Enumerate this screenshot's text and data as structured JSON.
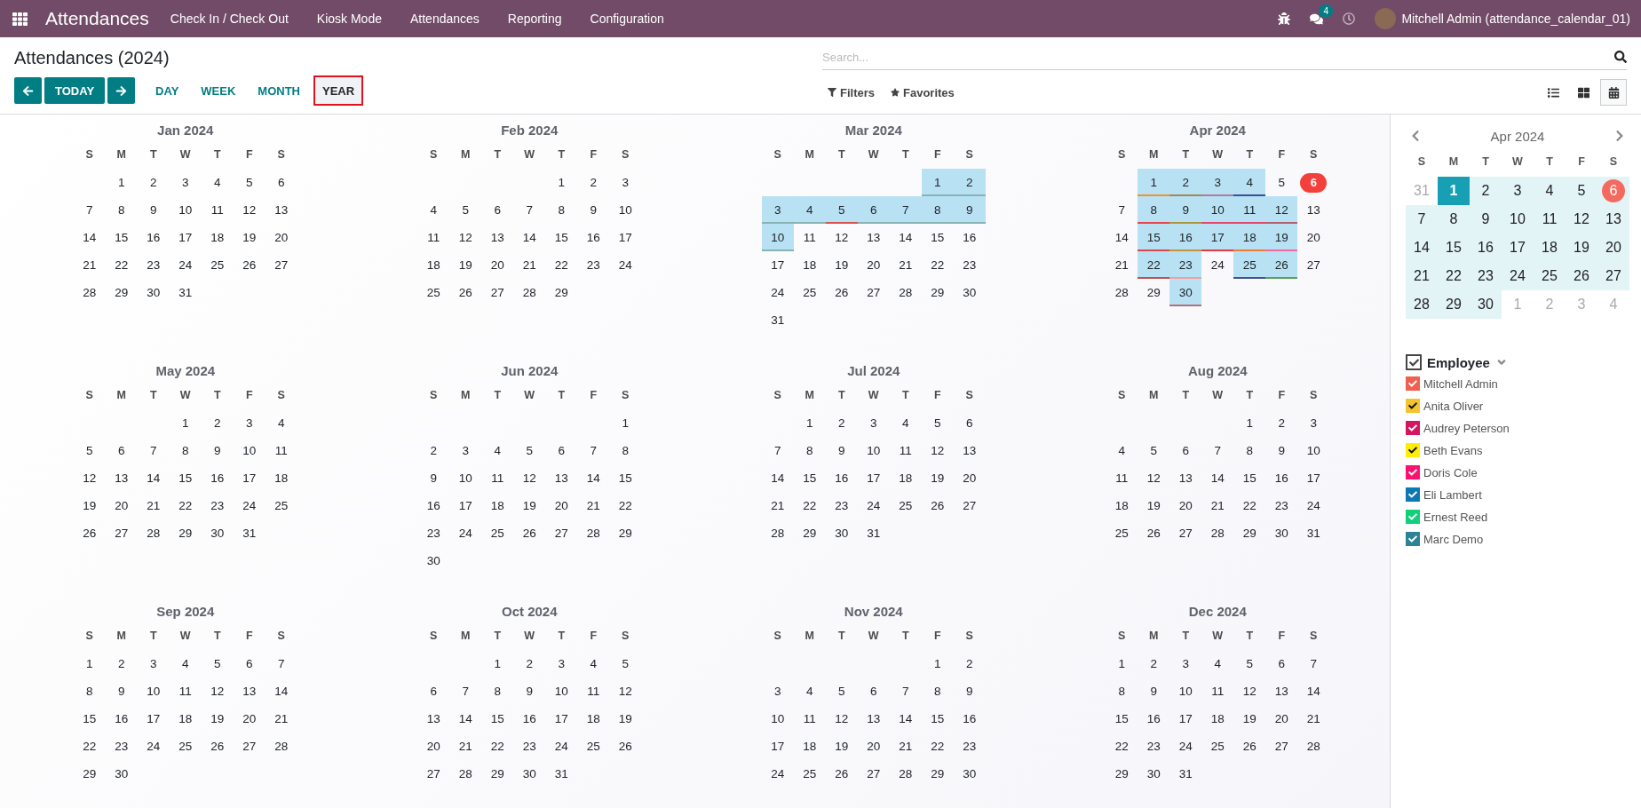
{
  "navbar": {
    "app_name": "Attendances",
    "menu": [
      "Check In / Check Out",
      "Kiosk Mode",
      "Attendances",
      "Reporting",
      "Configuration"
    ],
    "chat_count": "4",
    "user": "Mitchell Admin (attendance_calendar_01)"
  },
  "control_panel": {
    "title": "Attendances (2024)",
    "today_button": "TODAY",
    "scales": [
      {
        "label": "DAY",
        "selected": false
      },
      {
        "label": "WEEK",
        "selected": false
      },
      {
        "label": "MONTH",
        "selected": false
      },
      {
        "label": "YEAR",
        "selected": true
      }
    ],
    "search": {
      "placeholder": "Search..."
    },
    "filters": "Filters",
    "favorites": "Favorites",
    "views": [
      {
        "kind": "list",
        "selected": false
      },
      {
        "kind": "kanban",
        "selected": false
      },
      {
        "kind": "calendar",
        "selected": true
      }
    ]
  },
  "months": [
    {
      "title": "Jan 2024",
      "weekdays": [
        "S",
        "M",
        "T",
        "W",
        "T",
        "F",
        "S"
      ],
      "weeks": [
        {
          "starts_midweek": true,
          "days": [
            "1",
            "2",
            "3",
            "4",
            "5",
            "6"
          ]
        },
        {
          "days": [
            "7",
            "8",
            "9",
            "10",
            "11",
            "12",
            "13"
          ]
        },
        {
          "days": [
            "14",
            "15",
            "16",
            "17",
            "18",
            "19",
            "20"
          ]
        },
        {
          "days": [
            "21",
            "22",
            "23",
            "24",
            "25",
            "26",
            "27"
          ]
        },
        {
          "starts_midweek": false,
          "days": [
            "28",
            "29",
            "30",
            "31"
          ]
        }
      ]
    },
    {
      "title": "Feb 2024",
      "weekdays": [
        "S",
        "M",
        "T",
        "W",
        "T",
        "F",
        "S"
      ],
      "weeks": [
        {
          "starts_midweek": true,
          "days": [
            "1",
            "2",
            "3"
          ]
        },
        {
          "days": [
            "4",
            "5",
            "6",
            "7",
            "8",
            "9",
            "10"
          ]
        },
        {
          "days": [
            "11",
            "12",
            "13",
            "14",
            "15",
            "16",
            "17"
          ]
        },
        {
          "days": [
            "18",
            "19",
            "20",
            "21",
            "22",
            "23",
            "24"
          ]
        },
        {
          "starts_midweek": false,
          "days": [
            "25",
            "26",
            "27",
            "28",
            "29"
          ]
        }
      ]
    },
    {
      "title": "Mar 2024",
      "weekdays": [
        "S",
        "M",
        "T",
        "W",
        "T",
        "F",
        "S"
      ],
      "weeks": [
        {
          "starts_midweek": true,
          "days": [
            {
              "day": "1",
              "color": "#86b4b4"
            },
            {
              "day": "2",
              "color": "#86b4b4"
            }
          ]
        },
        {
          "days": [
            {
              "day": "3",
              "color": "#86b4b4"
            },
            {
              "day": "4",
              "color": "#86b4b4"
            },
            {
              "day": "5",
              "color": "#d9534f"
            },
            {
              "day": "6",
              "color": "#86b4b4"
            },
            {
              "day": "7",
              "color": "#86b4b4"
            },
            {
              "day": "8",
              "color": "#86b4b4"
            },
            {
              "day": "9",
              "color": "#86b4b4"
            }
          ]
        },
        {
          "days": [
            {
              "day": "10",
              "color": "#86b4b4"
            },
            "11",
            "12",
            "13",
            "14",
            "15",
            "16"
          ]
        },
        {
          "days": [
            "17",
            "18",
            "19",
            "20",
            "21",
            "22",
            "23"
          ]
        },
        {
          "days": [
            "24",
            "25",
            "26",
            "27",
            "28",
            "29",
            "30"
          ]
        },
        {
          "starts_midweek": false,
          "days": [
            "31"
          ]
        }
      ]
    },
    {
      "title": "Apr 2024",
      "weekdays": [
        "S",
        "M",
        "T",
        "W",
        "T",
        "F",
        "S"
      ],
      "weeks": [
        {
          "starts_midweek": true,
          "days": [
            {
              "day": "1",
              "color": "#f0932b"
            },
            {
              "day": "2",
              "color": "#a08a4f"
            },
            {
              "day": "3",
              "color": "#b07a9a"
            },
            {
              "day": "4",
              "color": "#3a4f9a"
            },
            "5",
            {
              "day": "6",
              "today": true
            }
          ]
        },
        {
          "days": [
            "7",
            {
              "day": "8",
              "color": "#e5474b"
            },
            {
              "day": "9",
              "color": "#b0953f"
            },
            {
              "day": "10",
              "color": "#e5476b"
            },
            {
              "day": "11",
              "color": "#e0476b"
            },
            {
              "day": "12",
              "color": "#b06070"
            },
            "13"
          ]
        },
        {
          "days": [
            "14",
            {
              "day": "15",
              "color": "#d9474b"
            },
            {
              "day": "16",
              "color": "#c0943a"
            },
            {
              "day": "17",
              "color": "#e53945"
            },
            {
              "day": "18",
              "color": "#f07a30"
            },
            {
              "day": "19",
              "color": "#f06aa0"
            },
            "20"
          ]
        },
        {
          "days": [
            "21",
            {
              "day": "22",
              "color": "#c0504d"
            },
            {
              "day": "23",
              "color": "#f0a0a0"
            },
            "24",
            {
              "day": "25",
              "color": "#4a4f8a"
            },
            {
              "day": "26",
              "color": "#5aa05a"
            },
            "27"
          ]
        },
        {
          "starts_midweek": false,
          "days": [
            "28",
            "29",
            {
              "day": "30",
              "color": "#b07080"
            }
          ]
        }
      ]
    },
    {
      "title": "May 2024",
      "weekdays": [
        "S",
        "M",
        "T",
        "W",
        "T",
        "F",
        "S"
      ],
      "weeks": [
        {
          "starts_midweek": true,
          "days": [
            "1",
            "2",
            "3",
            "4"
          ]
        },
        {
          "days": [
            "5",
            "6",
            "7",
            "8",
            "9",
            "10",
            "11"
          ]
        },
        {
          "days": [
            "12",
            "13",
            "14",
            "15",
            "16",
            "17",
            "18"
          ]
        },
        {
          "days": [
            "19",
            "20",
            "21",
            "22",
            "23",
            "24",
            "25"
          ]
        },
        {
          "starts_midweek": false,
          "days": [
            "26",
            "27",
            "28",
            "29",
            "30",
            "31"
          ]
        }
      ]
    },
    {
      "title": "Jun 2024",
      "weekdays": [
        "S",
        "M",
        "T",
        "W",
        "T",
        "F",
        "S"
      ],
      "weeks": [
        {
          "starts_midweek": true,
          "days": [
            "1"
          ]
        },
        {
          "days": [
            "2",
            "3",
            "4",
            "5",
            "6",
            "7",
            "8"
          ]
        },
        {
          "days": [
            "9",
            "10",
            "11",
            "12",
            "13",
            "14",
            "15"
          ]
        },
        {
          "days": [
            "16",
            "17",
            "18",
            "19",
            "20",
            "21",
            "22"
          ]
        },
        {
          "days": [
            "23",
            "24",
            "25",
            "26",
            "27",
            "28",
            "29"
          ]
        },
        {
          "starts_midweek": false,
          "days": [
            "30"
          ]
        }
      ]
    },
    {
      "title": "Jul 2024",
      "weekdays": [
        "S",
        "M",
        "T",
        "W",
        "T",
        "F",
        "S"
      ],
      "weeks": [
        {
          "starts_midweek": true,
          "days": [
            "1",
            "2",
            "3",
            "4",
            "5",
            "6"
          ]
        },
        {
          "days": [
            "7",
            "8",
            "9",
            "10",
            "11",
            "12",
            "13"
          ]
        },
        {
          "days": [
            "14",
            "15",
            "16",
            "17",
            "18",
            "19",
            "20"
          ]
        },
        {
          "days": [
            "21",
            "22",
            "23",
            "24",
            "25",
            "26",
            "27"
          ]
        },
        {
          "starts_midweek": false,
          "days": [
            "28",
            "29",
            "30",
            "31"
          ]
        }
      ]
    },
    {
      "title": "Aug 2024",
      "weekdays": [
        "S",
        "M",
        "T",
        "W",
        "T",
        "F",
        "S"
      ],
      "weeks": [
        {
          "starts_midweek": true,
          "days": [
            "1",
            "2",
            "3"
          ]
        },
        {
          "days": [
            "4",
            "5",
            "6",
            "7",
            "8",
            "9",
            "10"
          ]
        },
        {
          "days": [
            "11",
            "12",
            "13",
            "14",
            "15",
            "16",
            "17"
          ]
        },
        {
          "days": [
            "18",
            "19",
            "20",
            "21",
            "22",
            "23",
            "24"
          ]
        },
        {
          "days": [
            "25",
            "26",
            "27",
            "28",
            "29",
            "30",
            "31"
          ]
        }
      ]
    },
    {
      "title": "Sep 2024",
      "weekdays": [
        "S",
        "M",
        "T",
        "W",
        "T",
        "F",
        "S"
      ],
      "weeks": [
        {
          "days": [
            "1",
            "2",
            "3",
            "4",
            "5",
            "6",
            "7"
          ]
        },
        {
          "days": [
            "8",
            "9",
            "10",
            "11",
            "12",
            "13",
            "14"
          ]
        },
        {
          "days": [
            "15",
            "16",
            "17",
            "18",
            "19",
            "20",
            "21"
          ]
        },
        {
          "days": [
            "22",
            "23",
            "24",
            "25",
            "26",
            "27",
            "28"
          ]
        },
        {
          "starts_midweek": false,
          "days": [
            "29",
            "30"
          ]
        }
      ]
    },
    {
      "title": "Oct 2024",
      "weekdays": [
        "S",
        "M",
        "T",
        "W",
        "T",
        "F",
        "S"
      ],
      "weeks": [
        {
          "starts_midweek": true,
          "days": [
            "1",
            "2",
            "3",
            "4",
            "5"
          ]
        },
        {
          "days": [
            "6",
            "7",
            "8",
            "9",
            "10",
            "11",
            "12"
          ]
        },
        {
          "days": [
            "13",
            "14",
            "15",
            "16",
            "17",
            "18",
            "19"
          ]
        },
        {
          "days": [
            "20",
            "21",
            "22",
            "23",
            "24",
            "25",
            "26"
          ]
        },
        {
          "starts_midweek": false,
          "days": [
            "27",
            "28",
            "29",
            "30",
            "31"
          ]
        }
      ]
    },
    {
      "title": "Nov 2024",
      "weekdays": [
        "S",
        "M",
        "T",
        "W",
        "T",
        "F",
        "S"
      ],
      "weeks": [
        {
          "starts_midweek": true,
          "days": [
            "1",
            "2"
          ]
        },
        {
          "days": [
            "3",
            "4",
            "5",
            "6",
            "7",
            "8",
            "9"
          ]
        },
        {
          "days": [
            "10",
            "11",
            "12",
            "13",
            "14",
            "15",
            "16"
          ]
        },
        {
          "days": [
            "17",
            "18",
            "19",
            "20",
            "21",
            "22",
            "23"
          ]
        },
        {
          "days": [
            "24",
            "25",
            "26",
            "27",
            "28",
            "29",
            "30"
          ]
        }
      ]
    },
    {
      "title": "Dec 2024",
      "weekdays": [
        "S",
        "M",
        "T",
        "W",
        "T",
        "F",
        "S"
      ],
      "weeks": [
        {
          "days": [
            "1",
            "2",
            "3",
            "4",
            "5",
            "6",
            "7"
          ]
        },
        {
          "days": [
            "8",
            "9",
            "10",
            "11",
            "12",
            "13",
            "14"
          ]
        },
        {
          "days": [
            "15",
            "16",
            "17",
            "18",
            "19",
            "20",
            "21"
          ]
        },
        {
          "days": [
            "22",
            "23",
            "24",
            "25",
            "26",
            "27",
            "28"
          ]
        },
        {
          "starts_midweek": false,
          "days": [
            "29",
            "30",
            "31"
          ]
        }
      ]
    }
  ],
  "mini_calendar": {
    "title": "Apr 2024",
    "weekdays": [
      "S",
      "M",
      "T",
      "W",
      "T",
      "F",
      "S"
    ],
    "weeks": [
      [
        {
          "day": "31",
          "outside": true,
          "selected": false,
          "today": false
        },
        {
          "day": "1",
          "outside": false,
          "selected": true,
          "today": false
        },
        {
          "day": "2",
          "outside": false,
          "selected": false,
          "today": false
        },
        {
          "day": "3",
          "outside": false,
          "selected": false,
          "today": false
        },
        {
          "day": "4",
          "outside": false,
          "selected": false,
          "today": false
        },
        {
          "day": "5",
          "outside": false,
          "selected": false,
          "today": false
        },
        {
          "day": "6",
          "outside": false,
          "selected": false,
          "today": true
        }
      ],
      [
        {
          "day": "7",
          "outside": false,
          "selected": false,
          "today": false
        },
        {
          "day": "8",
          "outside": false,
          "selected": false,
          "today": false
        },
        {
          "day": "9",
          "outside": false,
          "selected": false,
          "today": false
        },
        {
          "day": "10",
          "outside": false,
          "selected": false,
          "today": false
        },
        {
          "day": "11",
          "outside": false,
          "selected": false,
          "today": false
        },
        {
          "day": "12",
          "outside": false,
          "selected": false,
          "today": false
        },
        {
          "day": "13",
          "outside": false,
          "selected": false,
          "today": false
        }
      ],
      [
        {
          "day": "14",
          "outside": false,
          "selected": false,
          "today": false
        },
        {
          "day": "15",
          "outside": false,
          "selected": false,
          "today": false
        },
        {
          "day": "16",
          "outside": false,
          "selected": false,
          "today": false
        },
        {
          "day": "17",
          "outside": false,
          "selected": false,
          "today": false
        },
        {
          "day": "18",
          "outside": false,
          "selected": false,
          "today": false
        },
        {
          "day": "19",
          "outside": false,
          "selected": false,
          "today": false
        },
        {
          "day": "20",
          "outside": false,
          "selected": false,
          "today": false
        }
      ],
      [
        {
          "day": "21",
          "outside": false,
          "selected": false,
          "today": false
        },
        {
          "day": "22",
          "outside": false,
          "selected": false,
          "today": false
        },
        {
          "day": "23",
          "outside": false,
          "selected": false,
          "today": false
        },
        {
          "day": "24",
          "outside": false,
          "selected": false,
          "today": false
        },
        {
          "day": "25",
          "outside": false,
          "selected": false,
          "today": false
        },
        {
          "day": "26",
          "outside": false,
          "selected": false,
          "today": false
        },
        {
          "day": "27",
          "outside": false,
          "selected": false,
          "today": false
        }
      ],
      [
        {
          "day": "28",
          "outside": false,
          "selected": false,
          "today": false
        },
        {
          "day": "29",
          "outside": false,
          "selected": false,
          "today": false
        },
        {
          "day": "30",
          "outside": false,
          "selected": false,
          "today": false
        },
        {
          "day": "1",
          "outside": true,
          "selected": false,
          "today": false
        },
        {
          "day": "2",
          "outside": true,
          "selected": false,
          "today": false
        },
        {
          "day": "3",
          "outside": true,
          "selected": false,
          "today": false
        },
        {
          "day": "4",
          "outside": true,
          "selected": false,
          "today": false
        }
      ]
    ]
  },
  "filter": {
    "title": "Employee",
    "checked": true,
    "items": [
      {
        "name": "Mitchell Admin",
        "color": "#f06050",
        "checked": true
      },
      {
        "name": "Anita Oliver",
        "color": "#f4c430",
        "checked": true
      },
      {
        "name": "Audrey Peterson",
        "color": "#d6145f",
        "checked": true
      },
      {
        "name": "Beth Evans",
        "color": "#ffee00",
        "checked": true
      },
      {
        "name": "Doris Cole",
        "color": "#ff0f6f",
        "checked": true
      },
      {
        "name": "Eli Lambert",
        "color": "#0c78b4",
        "checked": true
      },
      {
        "name": "Ernest Reed",
        "color": "#10d07a",
        "checked": true
      },
      {
        "name": "Marc Demo",
        "color": "#2c8397",
        "checked": true
      }
    ]
  }
}
